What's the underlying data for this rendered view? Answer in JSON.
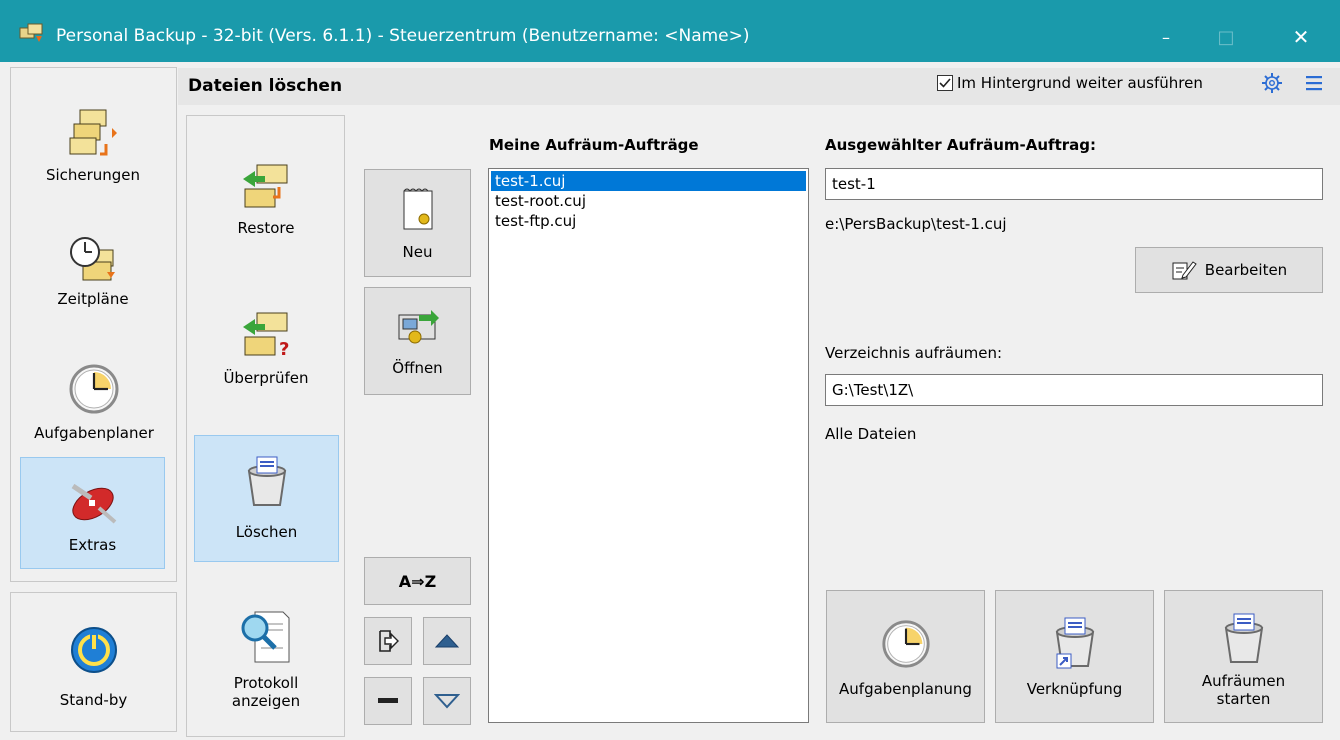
{
  "window": {
    "title": "Personal Backup - 32-bit (Vers. 6.1.1) - Steuerzentrum (Benutzername: <Name>)",
    "minimize_label": "–",
    "maximize_label": "□",
    "close_label": "✕"
  },
  "header": {
    "page_title": "Dateien löschen",
    "background_checkbox_label": "Im Hintergrund weiter ausführen",
    "background_checked": true
  },
  "left_nav": {
    "items": [
      {
        "label": "Sicherungen",
        "icon": "backup-folders-icon"
      },
      {
        "label": "Zeitpläne",
        "icon": "schedule-clock-icon"
      },
      {
        "label": "Aufgabenplaner",
        "icon": "clock-icon"
      },
      {
        "label": "Extras",
        "icon": "swiss-knife-icon"
      }
    ],
    "standby_label": "Stand-by"
  },
  "sub_nav": {
    "items": [
      {
        "label": "Restore"
      },
      {
        "label": "Überprüfen"
      },
      {
        "label": "Löschen"
      }
    ],
    "protokoll_line1": "Protokoll",
    "protokoll_line2": "anzeigen"
  },
  "tools": {
    "new_label": "Neu",
    "open_label": "Öffnen",
    "sort_label": "A⇒Z"
  },
  "jobs": {
    "heading": "Meine Aufräum-Aufträge",
    "items": [
      "test-1.cuj",
      "test-root.cuj",
      "test-ftp.cuj"
    ]
  },
  "selected_job": {
    "heading": "Ausgewählter Aufräum-Auftrag:",
    "name": "test-1",
    "path": "e:\\PersBackup\\test-1.cuj",
    "edit_label": "Bearbeiten",
    "dir_label": "Verzeichnis aufräumen:",
    "dir_value": "G:\\Test\\1Z\\",
    "files_label": "Alle Dateien"
  },
  "actions": {
    "schedule_label": "Aufgabenplanung",
    "shortcut_label": "Verknüpfung",
    "start_line1": "Aufräumen",
    "start_line2": "starten"
  },
  "colors": {
    "titlebar": "#1a9aab",
    "selection": "#0078d7",
    "selected_nav": "#cce4f7"
  }
}
